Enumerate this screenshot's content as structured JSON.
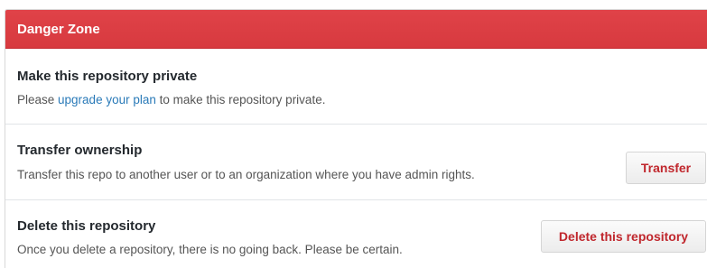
{
  "header": {
    "title": "Danger Zone"
  },
  "sections": [
    {
      "title": "Make this repository private",
      "description_before": "Please ",
      "link": "upgrade your plan",
      "description_after": " to make this repository private."
    },
    {
      "title": "Transfer ownership",
      "description": "Transfer this repo to another user or to an organization where you have admin rights.",
      "button": "Transfer"
    },
    {
      "title": "Delete this repository",
      "description": "Once you delete a repository, there is no going back. Please be certain.",
      "button": "Delete this repository"
    }
  ],
  "colors": {
    "header_bg": "#d73a3f",
    "danger_text": "#c0272d",
    "link": "#2a7ab8"
  }
}
